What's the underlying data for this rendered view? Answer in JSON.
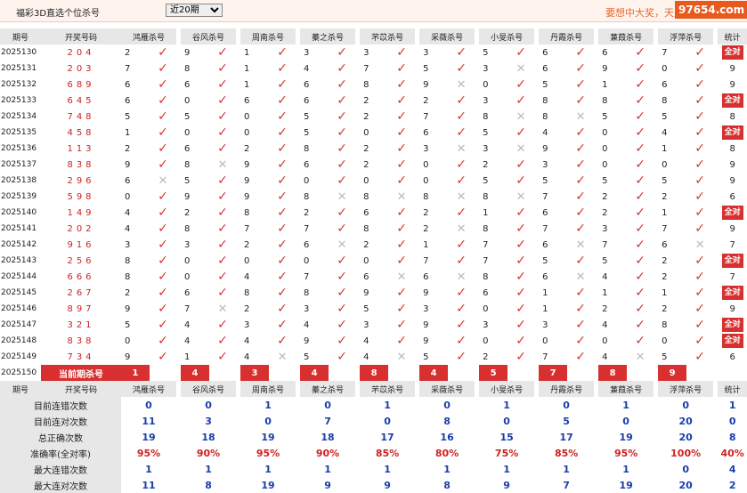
{
  "topbar": {
    "title": "福彩3D直选个位杀号",
    "period_select": "近20期",
    "slogan": "要想中大奖，天天",
    "watermark": "97654.com"
  },
  "columns": {
    "issue": "期号",
    "draw": "开奖号码",
    "experts": [
      "鸿雁杀号",
      "谷风杀号",
      "周南杀号",
      "蓁之杀号",
      "芣苡杀号",
      "采薇杀号",
      "小旻杀号",
      "丹霞杀号",
      "蒹葭杀号",
      "浮萍杀号"
    ],
    "total": "统计"
  },
  "rows": [
    {
      "issue": "2025130",
      "draw": "204",
      "picks": [
        2,
        9,
        1,
        3,
        3,
        3,
        5,
        6,
        6,
        7
      ],
      "hits": [
        1,
        1,
        1,
        1,
        1,
        1,
        1,
        1,
        1,
        1
      ],
      "total": "全对"
    },
    {
      "issue": "2025131",
      "draw": "203",
      "picks": [
        7,
        8,
        1,
        4,
        7,
        5,
        3,
        6,
        9,
        0
      ],
      "hits": [
        1,
        1,
        1,
        1,
        1,
        1,
        0,
        1,
        1,
        1
      ],
      "total": "9"
    },
    {
      "issue": "2025132",
      "draw": "689",
      "picks": [
        6,
        6,
        1,
        6,
        8,
        9,
        0,
        5,
        1,
        6
      ],
      "hits": [
        1,
        1,
        1,
        1,
        1,
        0,
        1,
        1,
        1,
        1
      ],
      "total": "9"
    },
    {
      "issue": "2025133",
      "draw": "645",
      "picks": [
        6,
        0,
        6,
        6,
        2,
        2,
        3,
        8,
        8,
        8
      ],
      "hits": [
        1,
        1,
        1,
        1,
        1,
        1,
        1,
        1,
        1,
        1
      ],
      "total": "全对"
    },
    {
      "issue": "2025134",
      "draw": "748",
      "picks": [
        5,
        5,
        0,
        5,
        2,
        7,
        8,
        8,
        5,
        5
      ],
      "hits": [
        1,
        1,
        1,
        1,
        1,
        1,
        0,
        0,
        1,
        1
      ],
      "total": "8"
    },
    {
      "issue": "2025135",
      "draw": "458",
      "picks": [
        1,
        0,
        0,
        5,
        0,
        6,
        5,
        4,
        0,
        4
      ],
      "hits": [
        1,
        1,
        1,
        1,
        1,
        1,
        1,
        1,
        1,
        1
      ],
      "total": "全对"
    },
    {
      "issue": "2025136",
      "draw": "113",
      "picks": [
        2,
        6,
        2,
        8,
        2,
        3,
        3,
        9,
        0,
        1
      ],
      "hits": [
        1,
        1,
        1,
        1,
        1,
        0,
        0,
        1,
        1,
        1
      ],
      "total": "8"
    },
    {
      "issue": "2025137",
      "draw": "838",
      "picks": [
        9,
        8,
        9,
        6,
        2,
        0,
        2,
        3,
        0,
        0
      ],
      "hits": [
        1,
        0,
        1,
        1,
        1,
        1,
        1,
        1,
        1,
        1
      ],
      "total": "9"
    },
    {
      "issue": "2025138",
      "draw": "296",
      "picks": [
        6,
        5,
        9,
        0,
        0,
        0,
        5,
        5,
        5,
        5
      ],
      "hits": [
        0,
        1,
        1,
        1,
        1,
        1,
        1,
        1,
        1,
        1
      ],
      "total": "9"
    },
    {
      "issue": "2025139",
      "draw": "598",
      "picks": [
        0,
        9,
        9,
        8,
        8,
        8,
        8,
        7,
        2,
        2
      ],
      "hits": [
        1,
        1,
        1,
        0,
        0,
        0,
        0,
        1,
        1,
        1
      ],
      "total": "6"
    },
    {
      "issue": "2025140",
      "draw": "149",
      "picks": [
        4,
        2,
        8,
        2,
        6,
        2,
        1,
        6,
        2,
        1
      ],
      "hits": [
        1,
        1,
        1,
        1,
        1,
        1,
        1,
        1,
        1,
        1
      ],
      "total": "全对"
    },
    {
      "issue": "2025141",
      "draw": "202",
      "picks": [
        4,
        8,
        7,
        7,
        8,
        2,
        8,
        7,
        3,
        7
      ],
      "hits": [
        1,
        1,
        1,
        1,
        1,
        0,
        1,
        1,
        1,
        1
      ],
      "total": "9"
    },
    {
      "issue": "2025142",
      "draw": "916",
      "picks": [
        3,
        3,
        2,
        6,
        2,
        1,
        7,
        6,
        7,
        6
      ],
      "hits": [
        1,
        1,
        1,
        0,
        1,
        1,
        1,
        0,
        1,
        0
      ],
      "total": "7"
    },
    {
      "issue": "2025143",
      "draw": "256",
      "picks": [
        8,
        0,
        0,
        0,
        0,
        7,
        7,
        5,
        5,
        2
      ],
      "hits": [
        1,
        1,
        1,
        1,
        1,
        1,
        1,
        1,
        1,
        1
      ],
      "total": "全对"
    },
    {
      "issue": "2025144",
      "draw": "666",
      "picks": [
        8,
        0,
        4,
        7,
        6,
        6,
        8,
        6,
        4,
        2
      ],
      "hits": [
        1,
        1,
        1,
        1,
        0,
        0,
        1,
        0,
        1,
        1
      ],
      "total": "7"
    },
    {
      "issue": "2025145",
      "draw": "267",
      "picks": [
        2,
        6,
        8,
        8,
        9,
        9,
        6,
        1,
        1,
        1
      ],
      "hits": [
        1,
        1,
        1,
        1,
        1,
        1,
        1,
        1,
        1,
        1
      ],
      "total": "全对"
    },
    {
      "issue": "2025146",
      "draw": "897",
      "picks": [
        9,
        7,
        2,
        3,
        5,
        3,
        0,
        1,
        2,
        2
      ],
      "hits": [
        1,
        0,
        1,
        1,
        1,
        1,
        1,
        1,
        1,
        1
      ],
      "total": "9"
    },
    {
      "issue": "2025147",
      "draw": "321",
      "picks": [
        5,
        4,
        3,
        4,
        3,
        9,
        3,
        3,
        4,
        8
      ],
      "hits": [
        1,
        1,
        1,
        1,
        1,
        1,
        1,
        1,
        1,
        1
      ],
      "total": "全对"
    },
    {
      "issue": "2025148",
      "draw": "838",
      "picks": [
        0,
        4,
        4,
        9,
        4,
        9,
        0,
        0,
        0,
        0
      ],
      "hits": [
        1,
        1,
        1,
        1,
        1,
        1,
        1,
        1,
        1,
        1
      ],
      "total": "全对"
    },
    {
      "issue": "2025149",
      "draw": "734",
      "picks": [
        9,
        1,
        4,
        5,
        4,
        5,
        2,
        7,
        4,
        5
      ],
      "hits": [
        1,
        1,
        0,
        1,
        0,
        1,
        1,
        1,
        0,
        1
      ],
      "total": "6"
    }
  ],
  "current": {
    "issue": "2025150",
    "label": "当前期杀号",
    "picks": [
      "1",
      "4",
      "3",
      "4",
      "8",
      "4",
      "5",
      "7",
      "8",
      "9"
    ]
  },
  "stats": {
    "header": {
      "label": "期号",
      "draw": "开奖号码",
      "total": "统计"
    },
    "rows": [
      {
        "label": "目前连错次数",
        "values": [
          "0",
          "0",
          "1",
          "0",
          "1",
          "0",
          "1",
          "0",
          "1",
          "0"
        ],
        "total": "1"
      },
      {
        "label": "目前连对次数",
        "values": [
          "11",
          "3",
          "0",
          "7",
          "0",
          "8",
          "0",
          "5",
          "0",
          "20"
        ],
        "total": "0"
      },
      {
        "label": "总正确次数",
        "values": [
          "19",
          "18",
          "19",
          "18",
          "17",
          "16",
          "15",
          "17",
          "19",
          "20"
        ],
        "total": "8"
      },
      {
        "label": "准确率(全对率)",
        "values": [
          "95%",
          "90%",
          "95%",
          "90%",
          "85%",
          "80%",
          "75%",
          "85%",
          "95%",
          "100%"
        ],
        "total": "40%"
      },
      {
        "label": "最大连错次数",
        "values": [
          "1",
          "1",
          "1",
          "1",
          "1",
          "1",
          "1",
          "1",
          "1",
          "0"
        ],
        "total": "4"
      },
      {
        "label": "最大连对次数",
        "values": [
          "11",
          "8",
          "19",
          "9",
          "9",
          "8",
          "9",
          "7",
          "19",
          "20"
        ],
        "total": "2"
      }
    ]
  },
  "colors": {
    "accent": "#d83030",
    "hit": "#d93333",
    "miss": "#bbbbbb",
    "blue": "#1a3eaa",
    "header_bg": "#e7e7e7"
  },
  "icons": {
    "hit": "check-mark-icon",
    "miss": "cross-mark-icon"
  }
}
